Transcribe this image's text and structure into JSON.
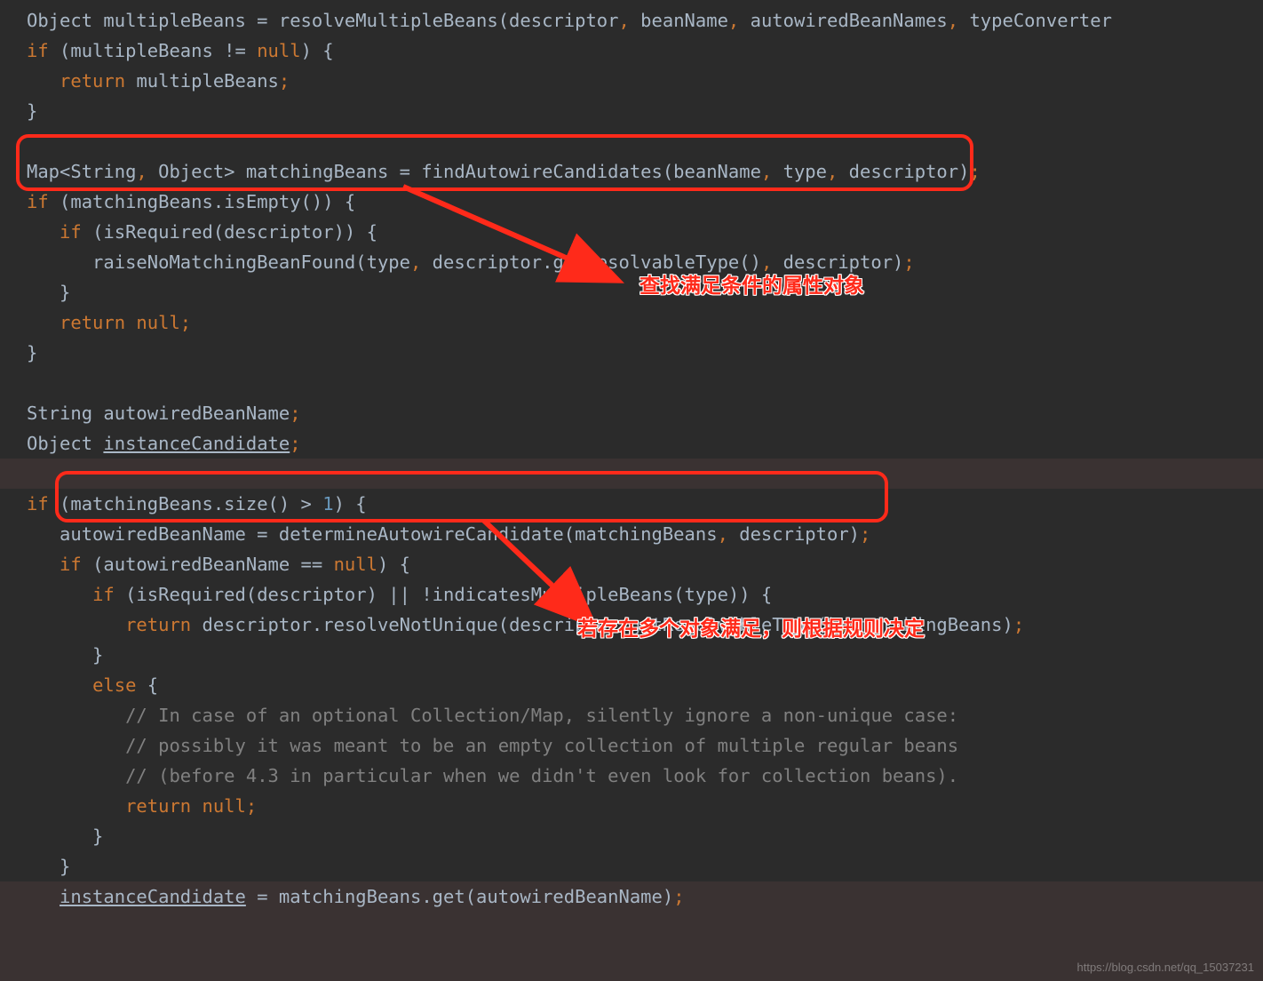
{
  "code": {
    "l1a": "Object multipleBeans = resolveMultipleBeans(descriptor",
    "l1b": ", ",
    "l1c": "beanName",
    "l1d": ", ",
    "l1e": "autowiredBeanNames",
    "l1f": ", ",
    "l1g": "typeConverter",
    "l2a": "if ",
    "l2b": "(multipleBeans != ",
    "l2c": "null",
    "l2d": ") {",
    "l3a": "   ",
    "l3b": "return ",
    "l3c": "multipleBeans",
    "l3d": ";",
    "l4a": "}",
    "l6a": "Map<String",
    "l6b": ", ",
    "l6c": "Object> matchingBeans = findAutowireCandidates(beanName",
    "l6d": ", ",
    "l6e": "type",
    "l6f": ", ",
    "l6g": "descriptor)",
    "l6h": ";",
    "l7a": "if ",
    "l7b": "(matchingBeans.isEmpty()) {",
    "l8a": "   ",
    "l8b": "if ",
    "l8c": "(isRequired(descriptor)) {",
    "l9a": "      raiseNoMatchingBeanFound(type",
    "l9b": ", ",
    "l9c": "descriptor.getResolvableType()",
    "l9d": ", ",
    "l9e": "descriptor)",
    "l9f": ";",
    "l10a": "   }",
    "l11a": "   ",
    "l11b": "return null;",
    "l12a": "}",
    "l14a": "String autowiredBeanName",
    "l14b": ";",
    "l15a": "Object ",
    "l15b": "instanceCandidate",
    "l15c": ";",
    "l17a": "if ",
    "l17b": "(matchingBeans.size() > ",
    "l17c": "1",
    "l17d": ") {",
    "l18a": "   autowiredBeanName = determineAutowireCandidate(matchingBeans",
    "l18b": ", ",
    "l18c": "descriptor)",
    "l18d": ";",
    "l19a": "   ",
    "l19b": "if ",
    "l19c": "(autowiredBeanName == ",
    "l19d": "null",
    "l19e": ") {",
    "l20a": "      ",
    "l20b": "if ",
    "l20c": "(isRequired(descriptor) || !indicatesMultipleBeans(type)) {",
    "l21a": "         ",
    "l21b": "return ",
    "l21c": "descriptor.resolveNotUnique(descriptor.getResolvableType()",
    "l21d": ", ",
    "l21e": "matchingBeans)",
    "l21f": ";",
    "l22a": "      }",
    "l23a": "      ",
    "l23b": "else ",
    "l23c": "{",
    "l24a": "         ",
    "l24b": "// In case of an optional Collection/Map, silently ignore a non-unique case:",
    "l25a": "         ",
    "l25b": "// possibly it was meant to be an empty collection of multiple regular beans",
    "l26a": "         ",
    "l26b": "// (before 4.3 in particular when we didn't even look for collection beans).",
    "l27a": "         ",
    "l27b": "return null;",
    "l28a": "      }",
    "l29a": "   }",
    "l30a": "   ",
    "l30b": "instanceCandidate",
    "l30c": " = matchingBeans.get(autowiredBeanName)",
    "l30d": ";"
  },
  "annotations": {
    "a1": "查找满足条件的属性对象",
    "a2": "若存在多个对象满足，则根据规则决定"
  },
  "watermark": "https://blog.csdn.net/qq_15037231"
}
